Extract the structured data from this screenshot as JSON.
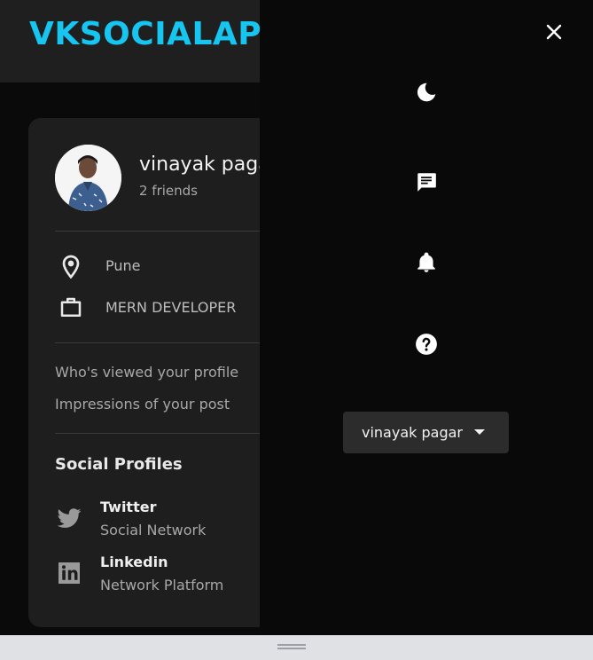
{
  "app": {
    "logo_text": "VKSOCIALAPP"
  },
  "profile": {
    "name": "vinayak pagar",
    "friends": "2 friends",
    "location": "Pune",
    "occupation": "MERN DEVELOPER"
  },
  "stats": {
    "viewed_label": "Who's viewed your profile",
    "impressions_label": "Impressions of your post"
  },
  "social": {
    "title": "Social Profiles",
    "items": [
      {
        "name": "Twitter",
        "sub": "Social Network",
        "icon": "twitter-icon"
      },
      {
        "name": "Linkedin",
        "sub": "Network Platform",
        "icon": "linkedin-icon"
      }
    ]
  },
  "drawer": {
    "icons": [
      "moon-icon",
      "message-icon",
      "bell-icon",
      "help-icon"
    ],
    "user_select": {
      "value": "vinayak pagar"
    }
  },
  "colors": {
    "accent": "#16c5f0",
    "drawer_bg": "#090909",
    "card_bg": "#1e1e1e"
  }
}
